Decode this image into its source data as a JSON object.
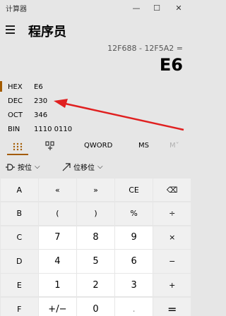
{
  "window": {
    "title": "计算器",
    "minimize_glyph": "—",
    "maximize_glyph": "☐",
    "close_glyph": "✕"
  },
  "header": {
    "mode_title": "程序员",
    "menu_icon": "hamburger-icon"
  },
  "display": {
    "expression": "12F688 - 12F5A2 =",
    "result": "E6"
  },
  "radix": [
    {
      "label": "HEX",
      "value": "E6",
      "selected": true
    },
    {
      "label": "DEC",
      "value": "230",
      "selected": false
    },
    {
      "label": "OCT",
      "value": "346",
      "selected": false
    },
    {
      "label": "BIN",
      "value": "1110 0110",
      "selected": false
    }
  ],
  "annotation": {
    "arrow_color": "#e02020"
  },
  "tabs": {
    "keypad_icon": "keypad-icon",
    "bit_toggle_icon": "bit-toggle-icon",
    "word_size": "QWORD",
    "memory_store": "MS",
    "memory_recall": "M˅"
  },
  "ops": {
    "bitwise_label": "按位",
    "bitwise_icon": "bitwise-icon",
    "shift_label": "位移位",
    "shift_icon": "shift-icon",
    "chevron": "⌵"
  },
  "keys": [
    [
      "A",
      "«",
      "»",
      "CE",
      "⌫"
    ],
    [
      "B",
      "(",
      ")",
      "%",
      "÷"
    ],
    [
      "C",
      "7",
      "8",
      "9",
      "×"
    ],
    [
      "D",
      "4",
      "5",
      "6",
      "−"
    ],
    [
      "E",
      "1",
      "2",
      "3",
      "+"
    ],
    [
      "F",
      "+/−",
      "0",
      ".",
      "="
    ]
  ],
  "colors": {
    "accent": "#a35b00",
    "background": "#e6e6e6",
    "number_key": "#ffffff",
    "function_key": "#f0f0f0"
  }
}
